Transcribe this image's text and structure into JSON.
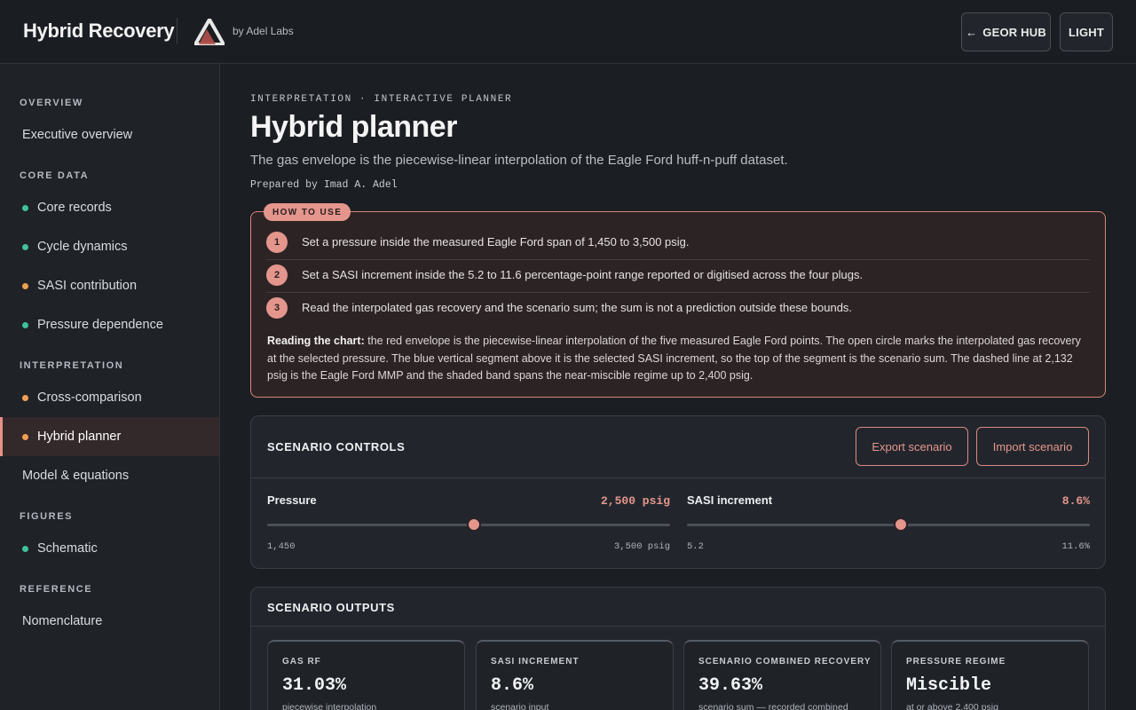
{
  "header": {
    "title": "Hybrid Recovery",
    "by": "by Adel Labs",
    "hub_button": "GEOR HUB",
    "theme_button": "LIGHT"
  },
  "sidebar": {
    "sections": [
      {
        "label": "OVERVIEW"
      },
      {
        "label": "CORE DATA"
      },
      {
        "label": "INTERPRETATION"
      },
      {
        "label": "FIGURES"
      },
      {
        "label": "REFERENCE"
      }
    ],
    "items": [
      {
        "label": "Executive overview",
        "dot": "none"
      },
      {
        "label": "Core records",
        "dot": "green"
      },
      {
        "label": "Cycle dynamics",
        "dot": "green"
      },
      {
        "label": "SASI contribution",
        "dot": "orange"
      },
      {
        "label": "Pressure dependence",
        "dot": "green"
      },
      {
        "label": "Cross-comparison",
        "dot": "orange"
      },
      {
        "label": "Hybrid planner",
        "dot": "orange",
        "active": true
      },
      {
        "label": "Model & equations",
        "dot": "none"
      },
      {
        "label": "Schematic",
        "dot": "green"
      },
      {
        "label": "Nomenclature",
        "dot": "none"
      }
    ]
  },
  "page": {
    "eyebrow": "INTERPRETATION · INTERACTIVE PLANNER",
    "title": "Hybrid planner",
    "subtitle": "The gas envelope is the piecewise-linear interpolation of the Eagle Ford huff-n-puff dataset.",
    "author": "Prepared by Imad A. Adel"
  },
  "howto": {
    "badge": "HOW TO USE",
    "steps": [
      {
        "num": "1",
        "text": "Set a pressure inside the measured Eagle Ford span of 1,450 to 3,500 psig."
      },
      {
        "num": "2",
        "text": "Set a SASI increment inside the 5.2 to 11.6 percentage-point range reported or digitised across the four plugs."
      },
      {
        "num": "3",
        "text": "Read the interpolated gas recovery and the scenario sum; the sum is not a prediction outside these bounds."
      }
    ],
    "reading_label": "Reading the chart:",
    "reading_text": " the red envelope is the piecewise-linear interpolation of the five measured Eagle Ford points. The open circle marks the interpolated gas recovery at the selected pressure. The blue vertical segment above it is the selected SASI increment, so the top of the segment is the scenario sum. The dashed line at 2,132 psig is the Eagle Ford MMP and the shaded band spans the near-miscible regime up to 2,400 psig."
  },
  "controls": {
    "title": "SCENARIO CONTROLS",
    "export_label": "Export scenario",
    "import_label": "Import scenario",
    "pressure": {
      "label": "Pressure",
      "value_text": "2,500 psig",
      "min_text": "1,450",
      "max_text": "3,500 psig",
      "min": 1450,
      "max": 3500,
      "value": 2500
    },
    "sasi": {
      "label": "SASI increment",
      "value_text": "8.6%",
      "min_text": "5.2",
      "max_text": "11.6%",
      "min": 5.2,
      "max": 11.6,
      "value": 8.6
    }
  },
  "outputs": {
    "title": "SCENARIO OUTPUTS",
    "cards": [
      {
        "label": "GAS RF",
        "value": "31.03%",
        "note": "piecewise interpolation"
      },
      {
        "label": "SASI INCREMENT",
        "value": "8.6%",
        "note": "scenario input"
      },
      {
        "label": "SCENARIO COMBINED RECOVERY",
        "value": "39.63%",
        "note": "scenario sum — recorded combined"
      },
      {
        "label": "PRESSURE REGIME",
        "value": "Miscible",
        "note": "at or above 2,400 psig"
      }
    ]
  },
  "colors": {
    "accent": "#e4968d",
    "green_dot": "#3ec29a",
    "orange_dot": "#f0a052",
    "background": "#1b1e23"
  },
  "icons": {
    "back": "arrow-left-icon",
    "logo": "triangle-logo-icon"
  }
}
